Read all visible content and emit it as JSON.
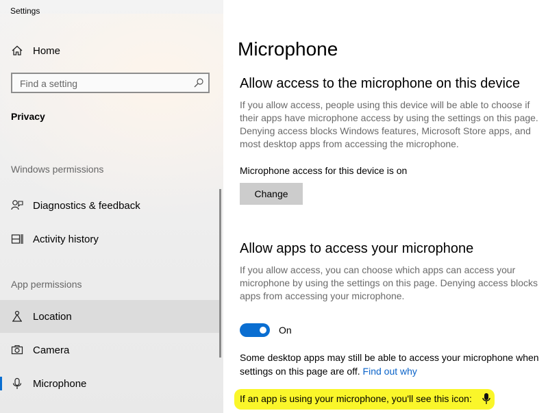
{
  "window": {
    "title": "Settings"
  },
  "sidebar": {
    "home_label": "Home",
    "search_placeholder": "Find a setting",
    "category": "Privacy",
    "sections": {
      "windows_permissions": "Windows permissions",
      "app_permissions": "App permissions"
    },
    "items": [
      {
        "label": "Diagnostics & feedback",
        "icon": "diagnostics-icon"
      },
      {
        "label": "Activity history",
        "icon": "activity-history-icon"
      },
      {
        "label": "Location",
        "icon": "location-icon"
      },
      {
        "label": "Camera",
        "icon": "camera-icon"
      },
      {
        "label": "Microphone",
        "icon": "microphone-icon",
        "selected": true
      }
    ]
  },
  "main": {
    "title": "Microphone",
    "device_section": {
      "heading": "Allow access to the microphone on this device",
      "description": "If you allow access, people using this device will be able to choose if their apps have microphone access by using the settings on this page. Denying access blocks Windows features, Microsoft Store apps, and most desktop apps from accessing the microphone.",
      "status": "Microphone access for this device is on",
      "change_button": "Change"
    },
    "apps_section": {
      "heading": "Allow apps to access your microphone",
      "description": "If you allow access, you can choose which apps can access your microphone by using the settings on this page. Denying access blocks apps from accessing your microphone.",
      "toggle_state": "On",
      "toggle_on": true,
      "note": "Some desktop apps may still be able to access your microphone when settings on this page are off.",
      "note_link": "Find out why",
      "icon_notice": "If an app is using your microphone, you'll see this icon:"
    }
  },
  "colors": {
    "accent": "#0a6ed1",
    "highlight": "#faf62a",
    "link": "#0a63c9"
  }
}
